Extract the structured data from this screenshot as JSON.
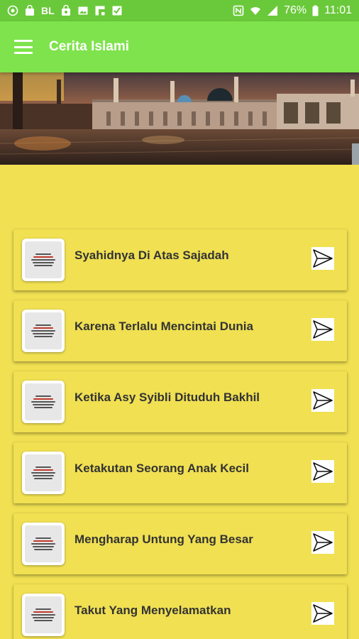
{
  "status_bar": {
    "left_icons": [
      "sim-status-icon",
      "bag-icon",
      "bl-text-icon",
      "shopping-bag-icon",
      "image-icon",
      "flipboard-icon",
      "tasks-icon"
    ],
    "bl_text": "BL",
    "nfc": "N",
    "battery": "76%",
    "time": "11:01"
  },
  "app_bar": {
    "title": "Cerita Islami"
  },
  "stories": [
    {
      "title": "Syahidnya Di Atas Sajadah"
    },
    {
      "title": "Karena Terlalu Mencintai Dunia"
    },
    {
      "title": "Ketika Asy Syibli Dituduh Bakhil"
    },
    {
      "title": "Ketakutan Seorang Anak Kecil"
    },
    {
      "title": "Mengharap Untung Yang Besar"
    },
    {
      "title": "Takut Yang Menyelamatkan"
    }
  ],
  "colors": {
    "status_bar": "#6ac93a",
    "app_bar": "#7ee34c",
    "background": "#f0e052"
  }
}
